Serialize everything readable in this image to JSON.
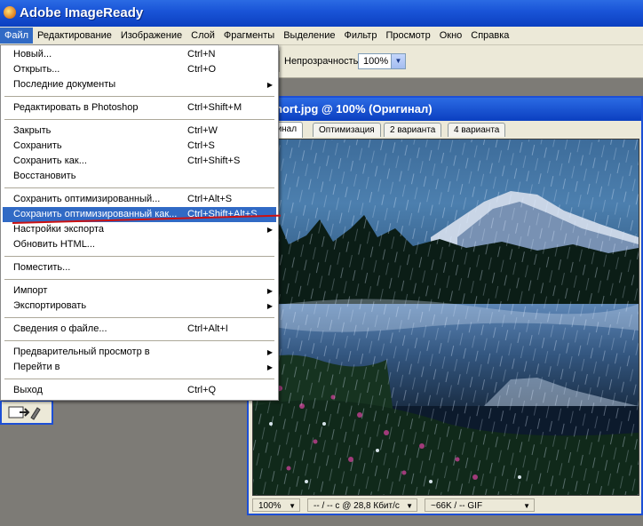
{
  "app": {
    "title": "Adobe ImageReady"
  },
  "menubar": {
    "items": [
      "Файл",
      "Редактирование",
      "Изображение",
      "Слой",
      "Фрагменты",
      "Выделение",
      "Фильтр",
      "Просмотр",
      "Окно",
      "Справка"
    ]
  },
  "options": {
    "opacity_label": "Непрозрачность:",
    "opacity_value": "100%"
  },
  "file_menu": {
    "items": [
      {
        "label": "Новый...",
        "shortcut": "Ctrl+N"
      },
      {
        "label": "Открыть...",
        "shortcut": "Ctrl+O"
      },
      {
        "label": "Последние документы",
        "shortcut": "",
        "submenu": true
      },
      {
        "label": "Редактировать в Photoshop",
        "shortcut": "Ctrl+Shift+M"
      },
      {
        "label": "Закрыть",
        "shortcut": "Ctrl+W"
      },
      {
        "label": "Сохранить",
        "shortcut": "Ctrl+S"
      },
      {
        "label": "Сохранить как...",
        "shortcut": "Ctrl+Shift+S"
      },
      {
        "label": "Восстановить",
        "shortcut": ""
      },
      {
        "label": "Сохранить оптимизированный...",
        "shortcut": "Ctrl+Alt+S"
      },
      {
        "label": "Сохранить оптимизированный как...",
        "shortcut": "Ctrl+Shift+Alt+S",
        "highlighted": true
      },
      {
        "label": "Настройки экспорта",
        "shortcut": "",
        "submenu": true
      },
      {
        "label": "Обновить HTML...",
        "shortcut": ""
      },
      {
        "label": "Поместить...",
        "shortcut": ""
      },
      {
        "label": "Импорт",
        "shortcut": "",
        "submenu": true
      },
      {
        "label": "Экспортировать",
        "shortcut": "",
        "submenu": true
      },
      {
        "label": "Сведения о файле...",
        "shortcut": "Ctrl+Alt+I"
      },
      {
        "label": "Предварительный просмотр в",
        "shortcut": "",
        "submenu": true
      },
      {
        "label": "Перейти в",
        "shortcut": "",
        "submenu": true
      },
      {
        "label": "Выход",
        "shortcut": "Ctrl+Q"
      }
    ]
  },
  "document": {
    "title": "nort.jpg @ 100% (Оригинал)",
    "tabs": [
      "Оригинал",
      "Оптимизация",
      "2 варианта",
      "4 варианта"
    ],
    "status": {
      "zoom": "100%",
      "speed": "-- / -- с @ 28,8 Кбит/с",
      "size": "~66K / -- GIF"
    }
  },
  "colors": {
    "accent": "#316ac5",
    "titlebar": "#0b3fc0",
    "annotation": "#cc1111"
  },
  "icons": {
    "submenu": "triangle-right-icon",
    "dropdown": "chevron-down-icon"
  }
}
